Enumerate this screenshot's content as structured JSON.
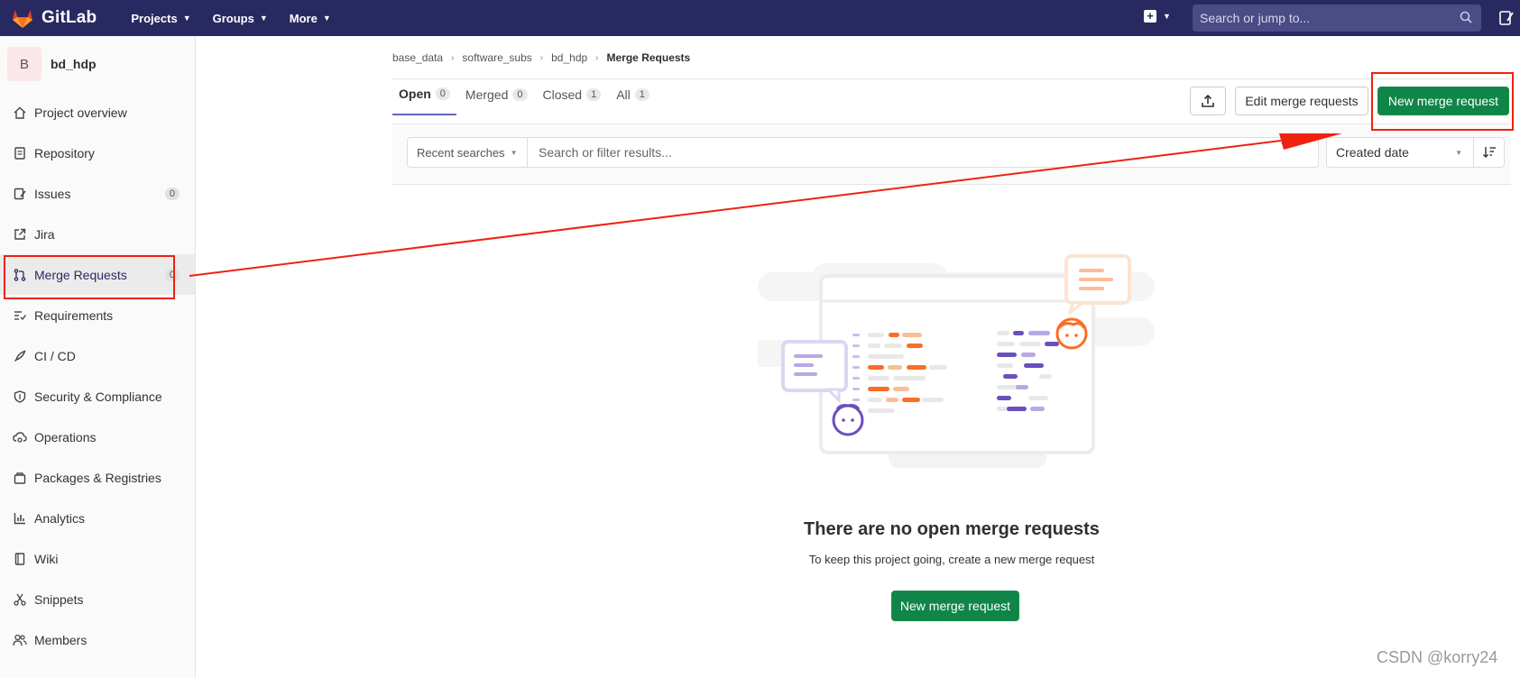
{
  "header": {
    "brand": "GitLab",
    "nav": [
      {
        "label": "Projects"
      },
      {
        "label": "Groups"
      },
      {
        "label": "More"
      }
    ],
    "search_placeholder": "Search or jump to...",
    "icons": {
      "logo": "gitlab-tanuki-icon",
      "plus": "plus-square-icon",
      "search": "search-icon",
      "todo": "todo-edit-icon"
    }
  },
  "sidebar": {
    "avatar_letter": "B",
    "project_name": "bd_hdp",
    "items": [
      {
        "label": "Project overview",
        "icon": "home-icon"
      },
      {
        "label": "Repository",
        "icon": "doc-icon"
      },
      {
        "label": "Issues",
        "icon": "issues-icon",
        "count": "0"
      },
      {
        "label": "Jira",
        "icon": "external-link-icon"
      },
      {
        "label": "Merge Requests",
        "icon": "git-merge-icon",
        "count": "0"
      },
      {
        "label": "Requirements",
        "icon": "requirements-icon"
      },
      {
        "label": "CI / CD",
        "icon": "rocket-icon"
      },
      {
        "label": "Security & Compliance",
        "icon": "shield-icon"
      },
      {
        "label": "Operations",
        "icon": "cloud-gear-icon"
      },
      {
        "label": "Packages & Registries",
        "icon": "package-icon"
      },
      {
        "label": "Analytics",
        "icon": "chart-icon"
      },
      {
        "label": "Wiki",
        "icon": "book-icon"
      },
      {
        "label": "Snippets",
        "icon": "scissors-icon"
      },
      {
        "label": "Members",
        "icon": "users-icon"
      }
    ]
  },
  "breadcrumb": [
    "base_data",
    "software_subs",
    "bd_hdp",
    "Merge Requests"
  ],
  "tabs": [
    {
      "label": "Open",
      "count": "0"
    },
    {
      "label": "Merged",
      "count": "0"
    },
    {
      "label": "Closed",
      "count": "1"
    },
    {
      "label": "All",
      "count": "1"
    }
  ],
  "actions": {
    "export_icon": "export-upload-icon",
    "edit_label": "Edit merge requests",
    "new_label": "New merge request"
  },
  "filter": {
    "recent_label": "Recent searches",
    "search_placeholder": "Search or filter results...",
    "sort_label": "Created date",
    "sort_direction_icon": "sort-lowest-icon"
  },
  "empty_state": {
    "title": "There are no open merge requests",
    "subtitle": "To keep this project going, create a new merge request",
    "button_label": "New merge request"
  },
  "watermark": "CSDN @korry24",
  "colors": {
    "navbar": "#292961",
    "primary": "#108548",
    "annotation": "#ee2211"
  }
}
